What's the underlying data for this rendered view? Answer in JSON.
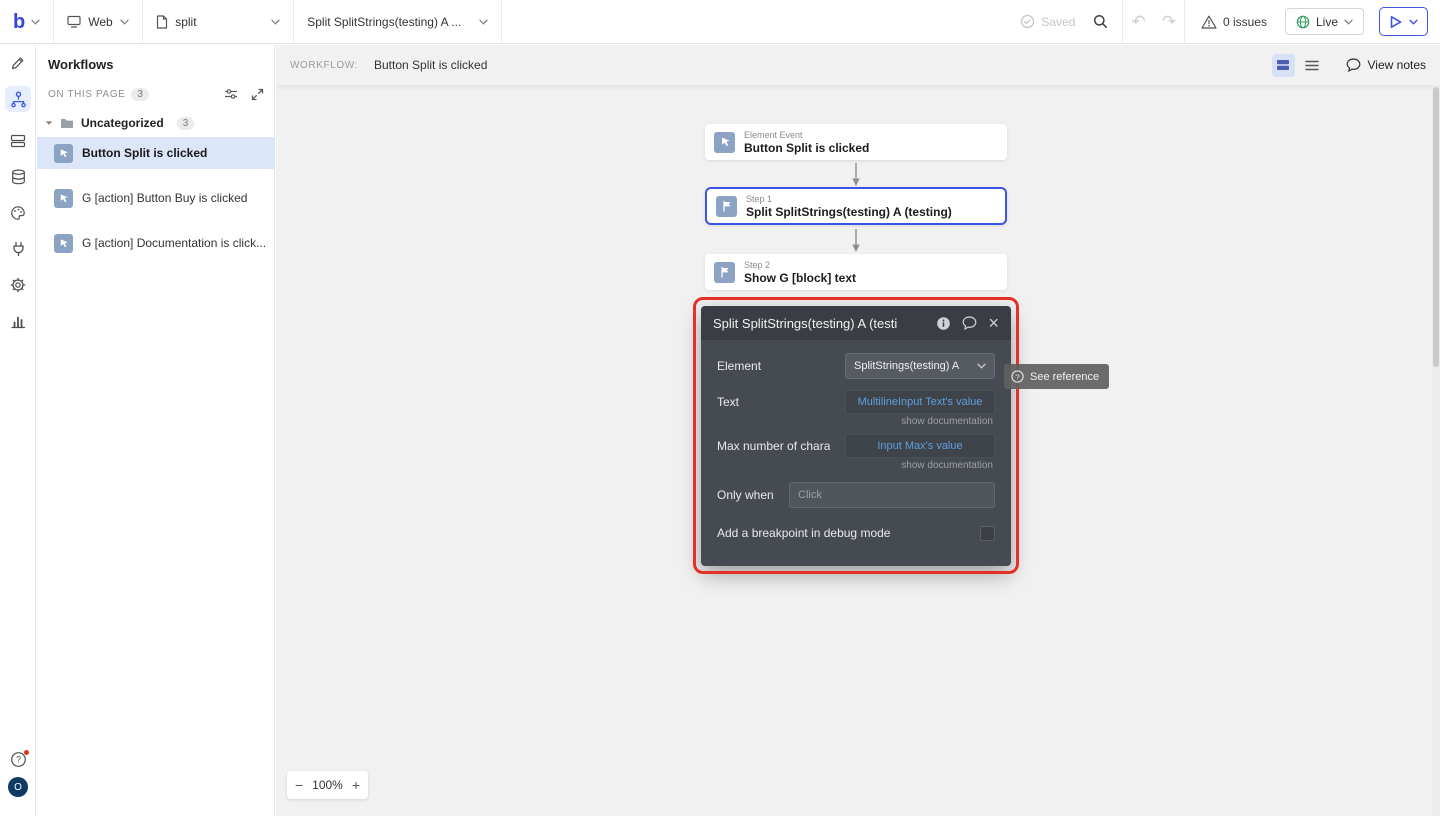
{
  "colors": {
    "accent": "#3b55e6",
    "live_green": "#2f9e5f",
    "annotation_red": "#e53026",
    "dynamic_blue": "#5d9fe0"
  },
  "topbar": {
    "logo": "b",
    "platform": "Web",
    "page": "split",
    "element": "Split SplitStrings(testing) A ...",
    "saved": "Saved",
    "issues": "0 issues",
    "live": "Live"
  },
  "rail": {
    "icons": [
      "design",
      "workflow",
      "pages",
      "data",
      "styles",
      "plugins",
      "settings",
      "logs"
    ],
    "avatar": "O"
  },
  "panel": {
    "title": "Workflows",
    "section": "ON THIS PAGE",
    "section_count": "3",
    "folder": "Uncategorized",
    "folder_count": "3",
    "items": [
      {
        "label": "Button Split is clicked"
      },
      {
        "label": "G [action] Button Buy is clicked"
      },
      {
        "label": "G [action] Documentation is click..."
      }
    ]
  },
  "canvas": {
    "workflow_label": "WORKFLOW:",
    "workflow_title": "Button Split is clicked",
    "view_notes": "View notes",
    "zoom_out": "−",
    "zoom_level": "100%",
    "zoom_in": "+",
    "nodes": [
      {
        "kind": "Element Event",
        "title": "Button Split is clicked"
      },
      {
        "kind": "Step 1",
        "title": "Split SplitStrings(testing) A (testing)"
      },
      {
        "kind": "Step 2",
        "title": "Show G [block] text"
      }
    ]
  },
  "popup": {
    "title": "Split SplitStrings(testing) A (testi",
    "element_label": "Element",
    "element_value": "SplitStrings(testing) A",
    "text_label": "Text",
    "text_value": "MultilineInput Text's value",
    "show_documentation": "show documentation",
    "max_label": "Max number of chara",
    "max_value": "Input Max's value",
    "only_when_label": "Only when",
    "only_when_placeholder": "Click",
    "breakpoint_label": "Add a breakpoint in debug mode"
  },
  "tooltip": {
    "label": "See reference"
  }
}
